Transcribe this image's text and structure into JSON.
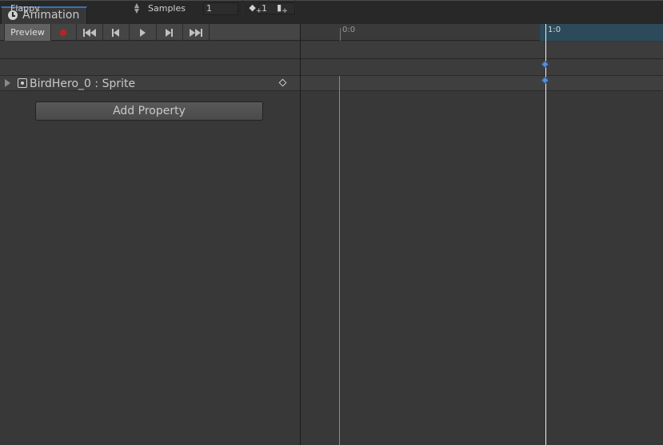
{
  "tab": {
    "title": "Animation",
    "icon": "clock-icon"
  },
  "toolbar": {
    "preview_label": "Preview",
    "record_icon": "record-icon",
    "first_key_icon": "first-keyframe-icon",
    "prev_key_icon": "previous-keyframe-icon",
    "play_icon": "play-icon",
    "next_key_icon": "next-keyframe-icon",
    "last_key_icon": "last-keyframe-icon",
    "frame_value": "1",
    "clip_name": "Flappy",
    "samples_label": "Samples",
    "samples_value": "1",
    "add_keyframe_icon": "add-keyframe-icon",
    "add_event_icon": "add-event-icon"
  },
  "properties": [
    {
      "name": "BirdHero_0 : Sprite",
      "icon": "sprite-icon"
    }
  ],
  "add_property_label": "Add Property",
  "timeline": {
    "ruler_labels": [
      "0:0",
      "1:0"
    ],
    "current_time": "1:0",
    "keyframes_at": [
      "1:0"
    ]
  },
  "colors": {
    "background": "#383838",
    "accent": "#3a72b0",
    "record": "#c02020",
    "keyframe": "#5b8fd6",
    "ruler_highlight": "#2c4a5a"
  }
}
